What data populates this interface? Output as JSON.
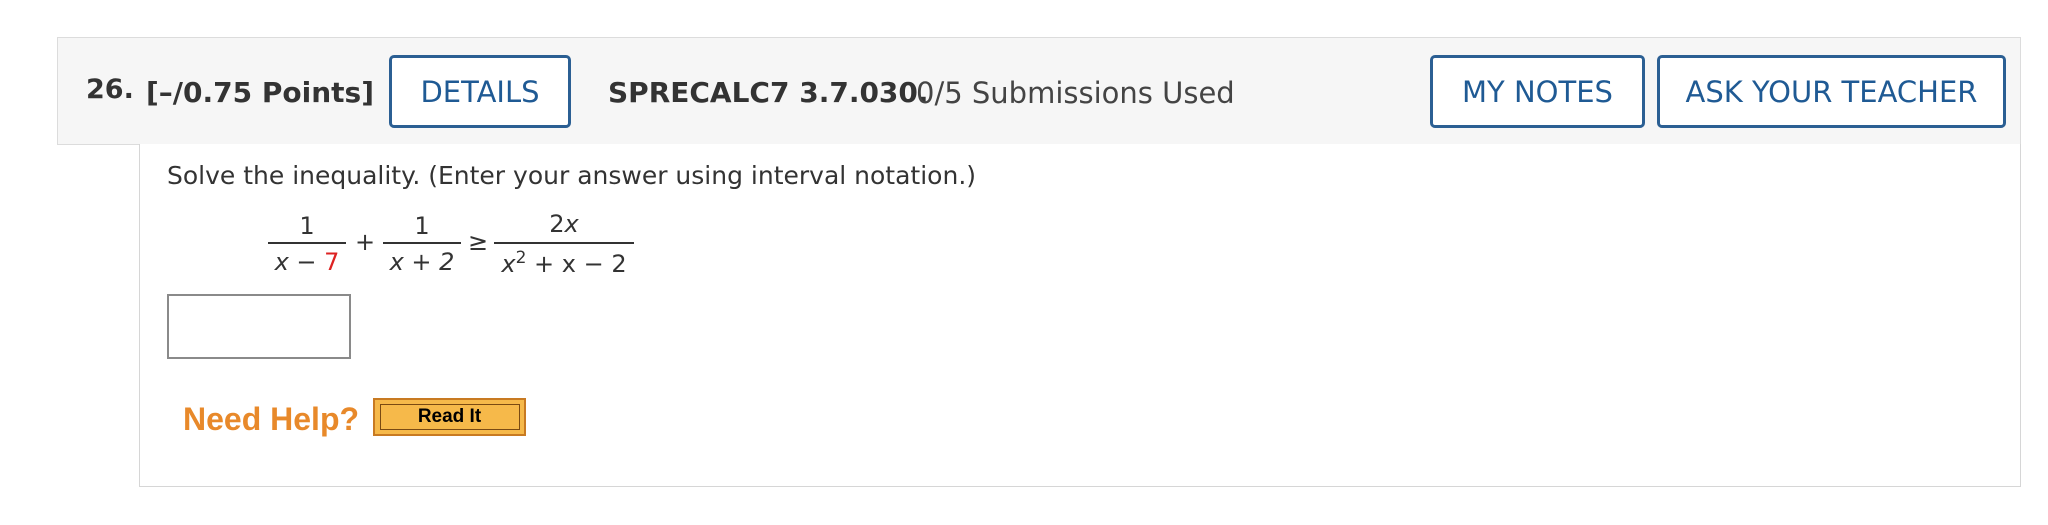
{
  "header": {
    "number": "26.",
    "points": "[–/0.75 Points]",
    "details_label": "DETAILS",
    "code": "SPRECALC7 3.7.030.",
    "submissions": "0/5 Submissions Used",
    "my_notes_label": "MY NOTES",
    "ask_teacher_label": "ASK YOUR TEACHER"
  },
  "question": {
    "prompt": "Solve the inequality. (Enter your answer using interval notation.)",
    "math": {
      "frac1_num": "1",
      "frac1_den_var": "x",
      "frac1_den_op": " − ",
      "frac1_den_const": "7",
      "plus": "+",
      "frac2_num": "1",
      "frac2_den": "x + 2",
      "relation": "≥",
      "frac3_num_coef": "2",
      "frac3_num_var": "x",
      "frac3_den_var": "x",
      "frac3_den_exp": "2",
      "frac3_den_rest": " + x − 2"
    },
    "answer_value": ""
  },
  "help": {
    "label": "Need Help?",
    "read_it_label": "Read It"
  },
  "colors": {
    "accent": "#2b5f93",
    "help_orange": "#e8892a",
    "highlight_red": "#dd2222"
  }
}
